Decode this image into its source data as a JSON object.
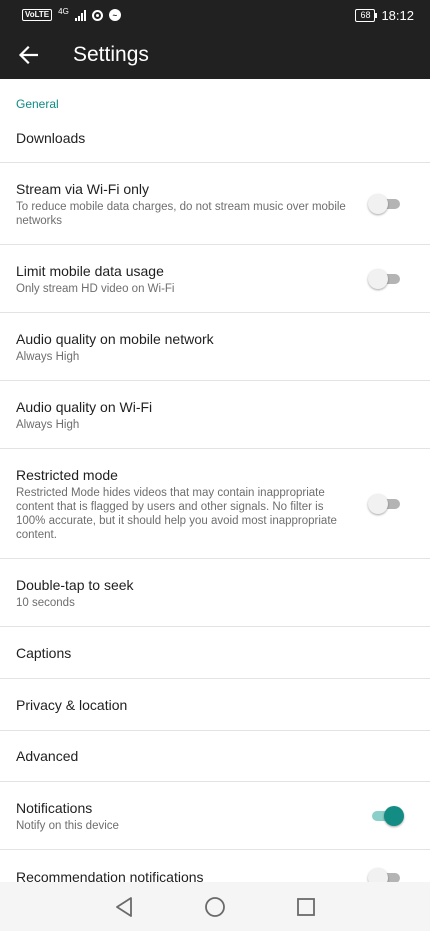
{
  "status_bar": {
    "volte": "VoLTE",
    "network": "4G",
    "battery": "68",
    "time": "18:12"
  },
  "app_bar": {
    "title": "Settings",
    "back_icon": "arrow-back-icon"
  },
  "section": {
    "header": "General"
  },
  "items": [
    {
      "title": "Downloads",
      "subtitle": ""
    },
    {
      "title": "Stream via Wi-Fi only",
      "subtitle": "To reduce mobile data charges, do not stream music over mobile networks",
      "toggle": false
    },
    {
      "title": "Limit mobile data usage",
      "subtitle": "Only stream HD video on Wi-Fi",
      "toggle": false
    },
    {
      "title": "Audio quality on mobile network",
      "subtitle": "Always High"
    },
    {
      "title": "Audio quality on Wi-Fi",
      "subtitle": "Always High"
    },
    {
      "title": "Restricted mode",
      "subtitle": "Restricted Mode hides videos that may contain inappropriate content that is flagged by users and other signals. No filter is 100% accurate, but it should help you avoid most inappropriate content.",
      "toggle": false
    },
    {
      "title": "Double-tap to seek",
      "subtitle": "10 seconds"
    },
    {
      "title": "Captions",
      "subtitle": ""
    },
    {
      "title": "Privacy & location",
      "subtitle": ""
    },
    {
      "title": "Advanced",
      "subtitle": ""
    },
    {
      "title": "Notifications",
      "subtitle": "Notify on this device",
      "toggle": true
    },
    {
      "title": "Recommendation notifications",
      "subtitle": "",
      "toggle": false
    }
  ],
  "colors": {
    "bar": "#212121",
    "accent": "#138c83",
    "section_header": "#0f8b85"
  },
  "nav": {
    "back_icon": "triangle-back-icon",
    "home_icon": "circle-home-icon",
    "recents_icon": "square-recents-icon"
  }
}
